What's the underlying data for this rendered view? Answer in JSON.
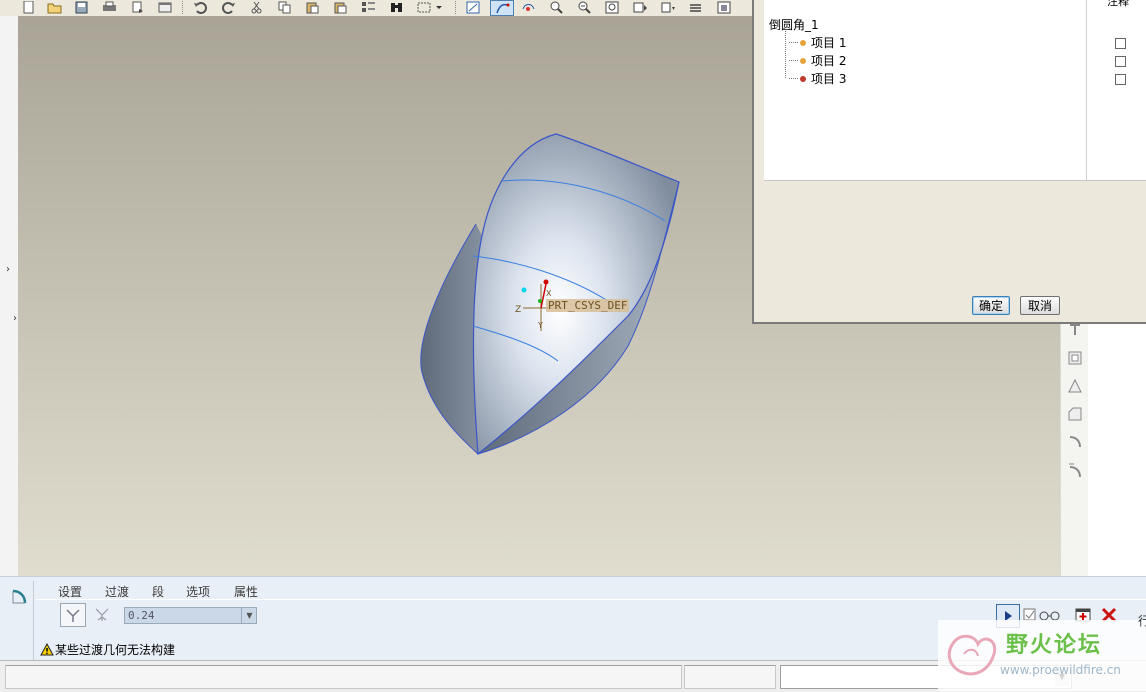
{
  "dialog": {
    "notes_header": "注释",
    "tree_root": "倒圆角_1",
    "items": [
      {
        "label": "项目 1",
        "dot_color": "#e6a23c"
      },
      {
        "label": "项目 2",
        "dot_color": "#e6a23c"
      },
      {
        "label": "项目 3",
        "dot_color": "#c0392b"
      }
    ],
    "ok_label": "确定",
    "cancel_label": "取消"
  },
  "viewport": {
    "csys_label": "PRT_CSYS_DEF",
    "axis_z": "Z",
    "axis_x": "X",
    "axis_y": "Y"
  },
  "dashboard": {
    "tabs": [
      "设置",
      "过渡",
      "段",
      "选项",
      "属性"
    ],
    "radius_value": "0.24",
    "warning_text": "某些过渡几何无法构建"
  },
  "watermark": {
    "title": "野火论坛",
    "url": "www.proewildfire.cn"
  },
  "edge_char": "行",
  "colors": {
    "viewport_top": "#a9a496",
    "viewport_bottom": "#e0ddcf",
    "surface_edge": "#3a56c8",
    "dashboard_bg": "#e9eff7",
    "delete_red": "#cc1111"
  }
}
